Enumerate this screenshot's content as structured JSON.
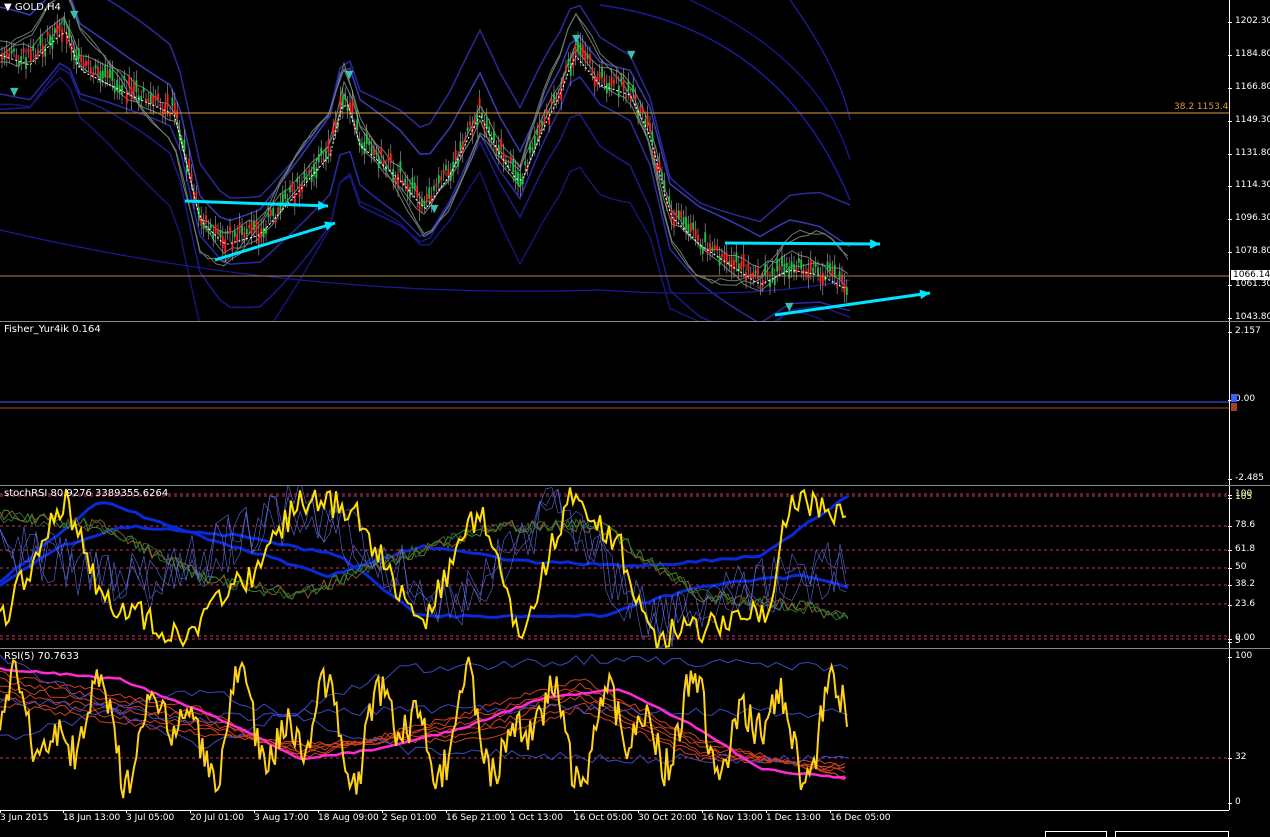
{
  "window": {
    "symbol_title": "GOLD,H4"
  },
  "main_pane": {
    "price_ticks": [
      "1202.30",
      "1184.80",
      "1166.80",
      "1149.30",
      "1131.80",
      "1114.30",
      "1096.30",
      "1078.80",
      "1061.30",
      "1043.80"
    ],
    "current_price": "1066.14",
    "fib_label": "38.2 1153.43",
    "colors": {
      "fib_line": "#d89a3a",
      "price_line": "#b08050",
      "arrows": "#00e5ff",
      "bands": "#1a1aa8",
      "envelope": "#6a7d73"
    }
  },
  "fisher_pane": {
    "title": "Fisher_Yur4ik 0.164",
    "ticks": [
      "2.157",
      "0.00",
      "-2.485"
    ],
    "colors": {
      "fast": "#f0a030",
      "slow": "#40b8ff",
      "fill_up": "#3a5a56",
      "fill_dn": "#5a1a9a",
      "hist": "#0000ff"
    }
  },
  "stoch_pane": {
    "title": "stochRSI 80.9276 3389355.6264",
    "ticks": [
      "100",
      "105",
      "78.6",
      "61.8",
      "50",
      "38.2",
      "23.6",
      "0.00",
      "5"
    ],
    "colors": {
      "main": "#ffe000",
      "band": "#0a2ad8",
      "levels": "#c8326a"
    }
  },
  "rsi_pane": {
    "title": "RSI(5) 70.7633",
    "ticks": [
      "100",
      "32",
      "0"
    ],
    "colors": {
      "main": "#ffd21a",
      "ma": "#ff2ad4",
      "env": "#d04020"
    }
  },
  "time_axis": {
    "labels": [
      "3 Jun 2015",
      "18 Jun 13:00",
      "3 Jul 05:00",
      "20 Jul 01:00",
      "3 Aug 17:00",
      "18 Aug 09:00",
      "2 Sep 01:00",
      "16 Sep 21:00",
      "1 Oct 13:00",
      "16 Oct 05:00",
      "30 Oct 20:00",
      "16 Nov 13:00",
      "1 Dec 13:00",
      "16 Dec 05:00"
    ]
  }
}
